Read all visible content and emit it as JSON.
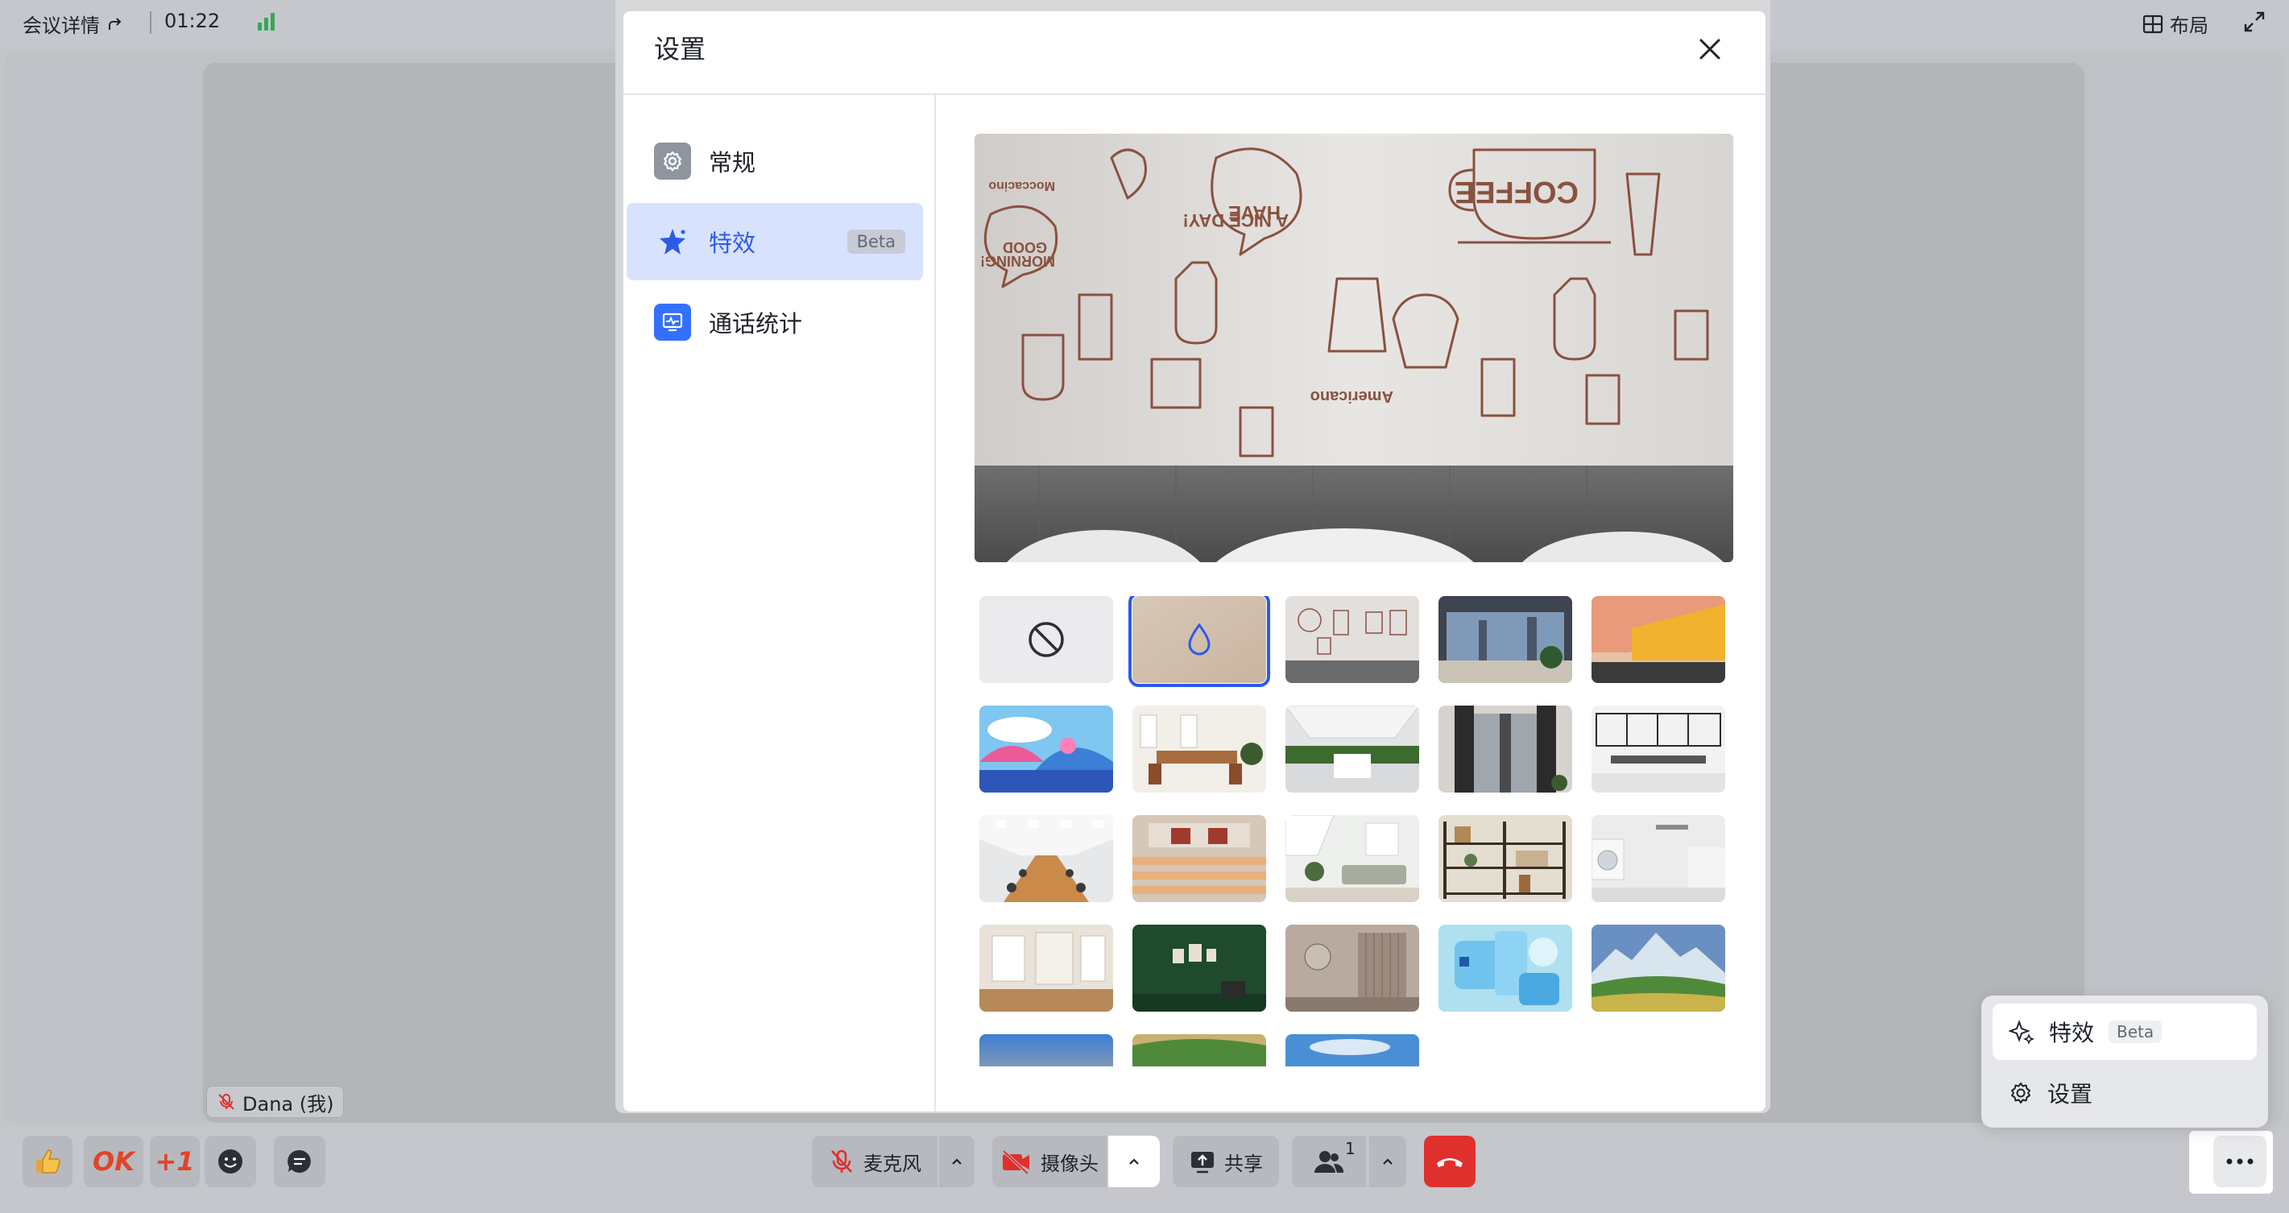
{
  "topbar": {
    "meeting_details": "会议详情",
    "time": "01:22",
    "layout_label": "布局"
  },
  "participant": {
    "name": "Dana (我)"
  },
  "toolbar": {
    "react_ok": "OK",
    "react_plus": "+1",
    "mic_label": "麦克风",
    "camera_label": "摄像头",
    "share_label": "共享",
    "participants_count": "1"
  },
  "popup": {
    "effects_label": "特效",
    "effects_badge": "Beta",
    "settings_label": "设置"
  },
  "modal": {
    "title": "设置",
    "nav": {
      "general": "常规",
      "effects": "特效",
      "effects_badge": "Beta",
      "call_stats": "通话统计"
    },
    "preview_text": {
      "coffee": "COFFEE",
      "have_nice_day_1": "HAVE",
      "have_nice_day_2": "A NICE DAY!",
      "good_morning_1": "GOOD",
      "good_morning_2": "MORNING!",
      "americano": "Americano",
      "moccacino": "Moccacino"
    }
  },
  "colors": {
    "accent": "#2b5ae8",
    "hangup": "#e0302d",
    "signal": "#34a853",
    "nav_active_bg": "#d9e2fd"
  },
  "backgrounds": [
    {
      "name": "none"
    },
    {
      "name": "blur",
      "selected": true
    },
    {
      "name": "coffee-wall"
    },
    {
      "name": "office-window-city"
    },
    {
      "name": "orange-wall-room"
    },
    {
      "name": "illustrated-islands"
    },
    {
      "name": "wood-meeting-room"
    },
    {
      "name": "green-plant-office"
    },
    {
      "name": "dark-doorway"
    },
    {
      "name": "white-conference-room"
    },
    {
      "name": "long-boardroom"
    },
    {
      "name": "lecture-hall"
    },
    {
      "name": "bright-living-room"
    },
    {
      "name": "bookshelf"
    },
    {
      "name": "white-laundry-room"
    },
    {
      "name": "empty-hall"
    },
    {
      "name": "green-wall-room"
    },
    {
      "name": "beige-interior"
    },
    {
      "name": "abstract-blue-shapes"
    },
    {
      "name": "mountain-landscape"
    },
    {
      "name": "sunset-sky"
    },
    {
      "name": "green-hills"
    },
    {
      "name": "blue-sky-clouds"
    }
  ]
}
